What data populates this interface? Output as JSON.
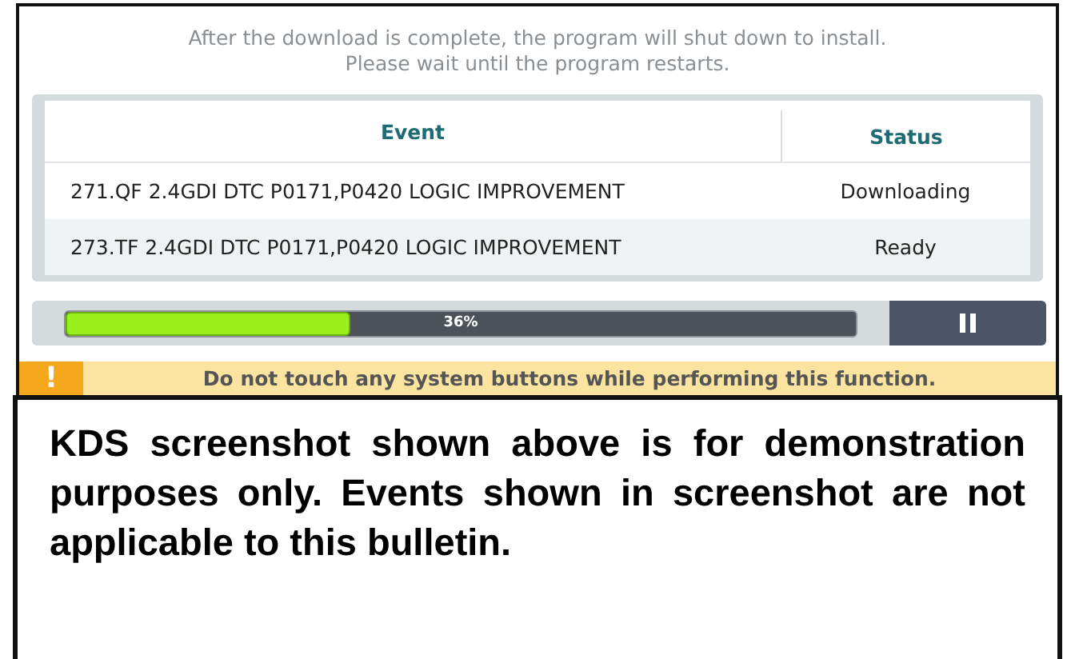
{
  "message": {
    "lines": [
      "After the download is complete, the program will shut down to install.",
      "Please wait until the program restarts."
    ]
  },
  "table": {
    "columns": [
      "Event",
      "Status"
    ],
    "rows": [
      {
        "event": "271.QF 2.4GDI DTC P0171,P0420 LOGIC IMPROVEMENT",
        "status": "Downloading",
        "shaded": false
      },
      {
        "event": "273.TF 2.4GDI DTC P0171,P0420 LOGIC IMPROVEMENT",
        "status": "Ready",
        "shaded": true
      }
    ]
  },
  "progress": {
    "level": 0.36,
    "reading": "36%"
  },
  "warning": {
    "icon": "!",
    "text": "Do not touch any system buttons while performing this function."
  },
  "caption": "KDS screenshot shown above is for demonstration purposes only. Events shown in screenshot are not applicable to this bulletin."
}
